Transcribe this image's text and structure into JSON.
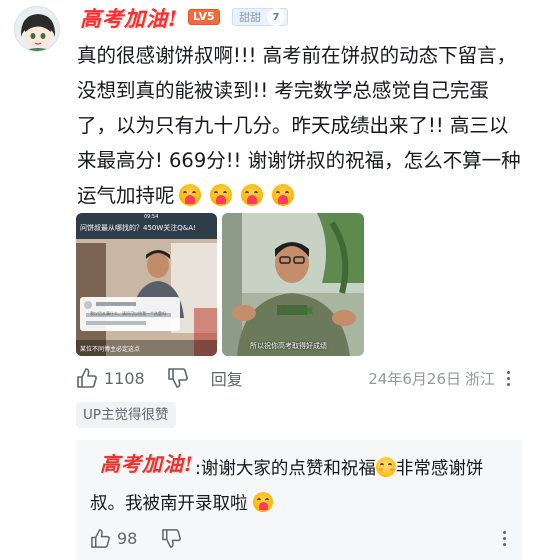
{
  "comment": {
    "author_logo_text": "高考加油!",
    "level_badge": "LV5",
    "fan_badge": {
      "name": "甜甜",
      "level": "7"
    },
    "text": "真的很感谢饼叔啊!!! 高考前在饼叔的动态下留言，没想到真的能被读到!! 考完数学总感觉自己完蛋了，以为只有九十几分。昨天成绩出来了!! 高三以来最高分! 669分!! 谢谢饼叔的祝福，怎么不算一种运气加持呢",
    "emoji_names": [
      "blush-heart-emoji",
      "blush-heart-emoji",
      "blush-heart-emoji",
      "blush-heart-emoji"
    ],
    "images": [
      {
        "top_caption": "09:54",
        "title": "问饼叔最从哪找的？450W关注Q&A!",
        "chat_line": "我以后从事什么，请问可以给我一个选题吗",
        "subtitle": "某位不同博主必定这点"
      },
      {
        "subtitle": "所以祝你高考取得好成绩",
        "shirt_text": "不要拍饼叔"
      }
    ],
    "like_count": "1108",
    "reply_label": "回复",
    "date": "24年6月26日",
    "location": "浙江",
    "up_tag": "UP主觉得很赞"
  },
  "reply": {
    "author_logo_text": "高考加油!",
    "text_part1": ":谢谢大家的点赞和祝福",
    "text_part2": "非常感谢饼叔。我被南开录取啦",
    "like_count": "98"
  },
  "colors": {
    "logo_red": "#ff2d2d",
    "text": "#18191c",
    "muted": "#9499a0",
    "reply_bg": "#f6f7f8"
  }
}
